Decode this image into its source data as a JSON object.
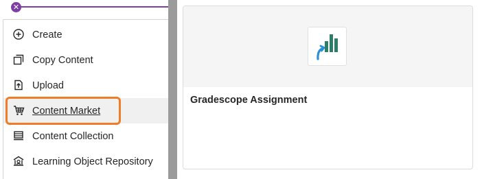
{
  "menu": {
    "items": [
      {
        "label": "Create",
        "icon": "plus-circle-icon"
      },
      {
        "label": "Copy Content",
        "icon": "copy-icon"
      },
      {
        "label": "Upload",
        "icon": "upload-icon"
      },
      {
        "label": "Content Market",
        "icon": "cart-icon",
        "active": true
      },
      {
        "label": "Content Collection",
        "icon": "collection-icon"
      },
      {
        "label": "Learning Object Repository",
        "icon": "repository-icon"
      }
    ]
  },
  "card": {
    "title": "Gradescope Assignment",
    "logo_icon": "gradescope-logo-icon"
  },
  "colors": {
    "accent_purple": "#7e3fa3",
    "highlight_orange": "#ef7d27",
    "logo_teal": "#2e7d6b",
    "logo_blue": "#2a8fd6"
  }
}
